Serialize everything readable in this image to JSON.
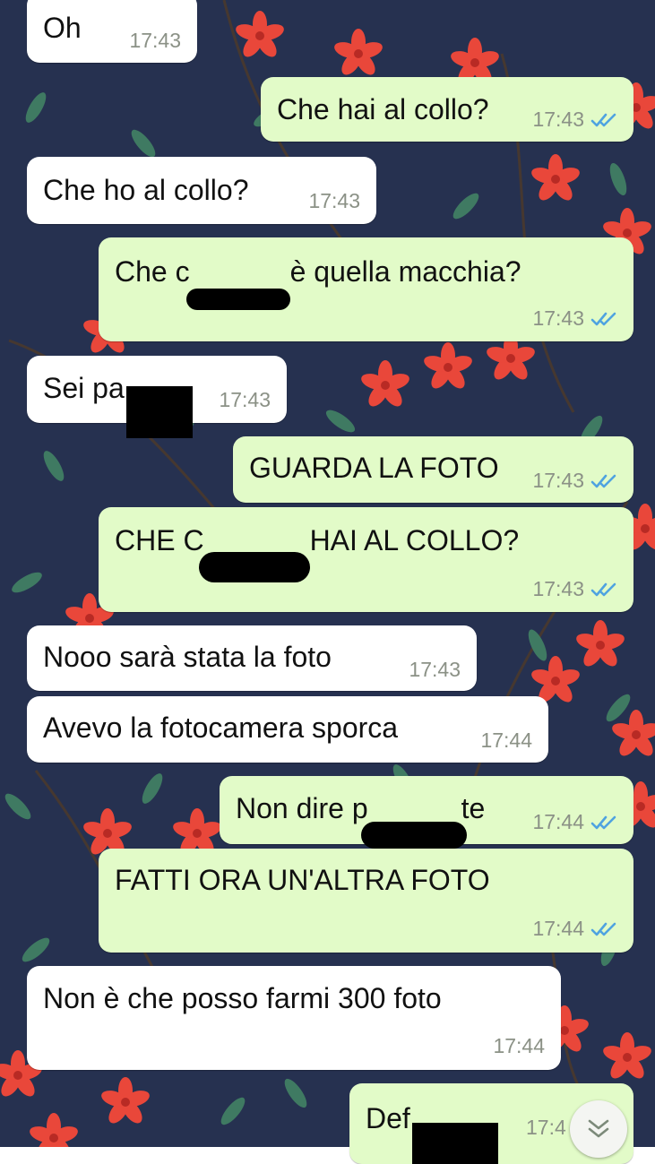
{
  "chat": {
    "wallpaper_color": "#263150",
    "bubble_incoming_color": "#ffffff",
    "bubble_outgoing_color": "#e2fbc8",
    "read_ticks_color": "#4fa3e0",
    "messages": [
      {
        "dir": "in",
        "text": "Oh",
        "time": "17:43"
      },
      {
        "dir": "out",
        "text": "Che hai al collo?",
        "time": "17:43",
        "status": "read"
      },
      {
        "dir": "in",
        "text": "Che ho al collo?",
        "time": "17:43"
      },
      {
        "dir": "out",
        "text_before": "Che c",
        "text_after": "è quella macchia?",
        "redacted": true,
        "time": "17:43",
        "status": "read"
      },
      {
        "dir": "in",
        "text_before": "Sei pa",
        "redacted": true,
        "time": "17:43"
      },
      {
        "dir": "out",
        "text": "GUARDA LA FOTO",
        "time": "17:43",
        "status": "read"
      },
      {
        "dir": "out",
        "text_before": "CHE C",
        "text_after": "HAI AL COLLO?",
        "redacted": true,
        "time": "17:43",
        "status": "read"
      },
      {
        "dir": "in",
        "text": "Nooo sarà stata la foto",
        "time": "17:43"
      },
      {
        "dir": "in",
        "text": "Avevo la fotocamera sporca",
        "time": "17:44"
      },
      {
        "dir": "out",
        "text_before": "Non dire p",
        "text_after": "te",
        "redacted": true,
        "time": "17:44",
        "status": "read"
      },
      {
        "dir": "out",
        "text": "FATTI ORA UN'ALTRA FOTO",
        "time": "17:44",
        "status": "read"
      },
      {
        "dir": "in",
        "text": "Non è che posso farmi 300 foto",
        "time": "17:44"
      },
      {
        "dir": "out",
        "text_before": "Def",
        "redacted": true,
        "time": "17:4",
        "status": "read"
      }
    ]
  },
  "scroll_button": {
    "icon": "double-chevron-down-icon"
  }
}
